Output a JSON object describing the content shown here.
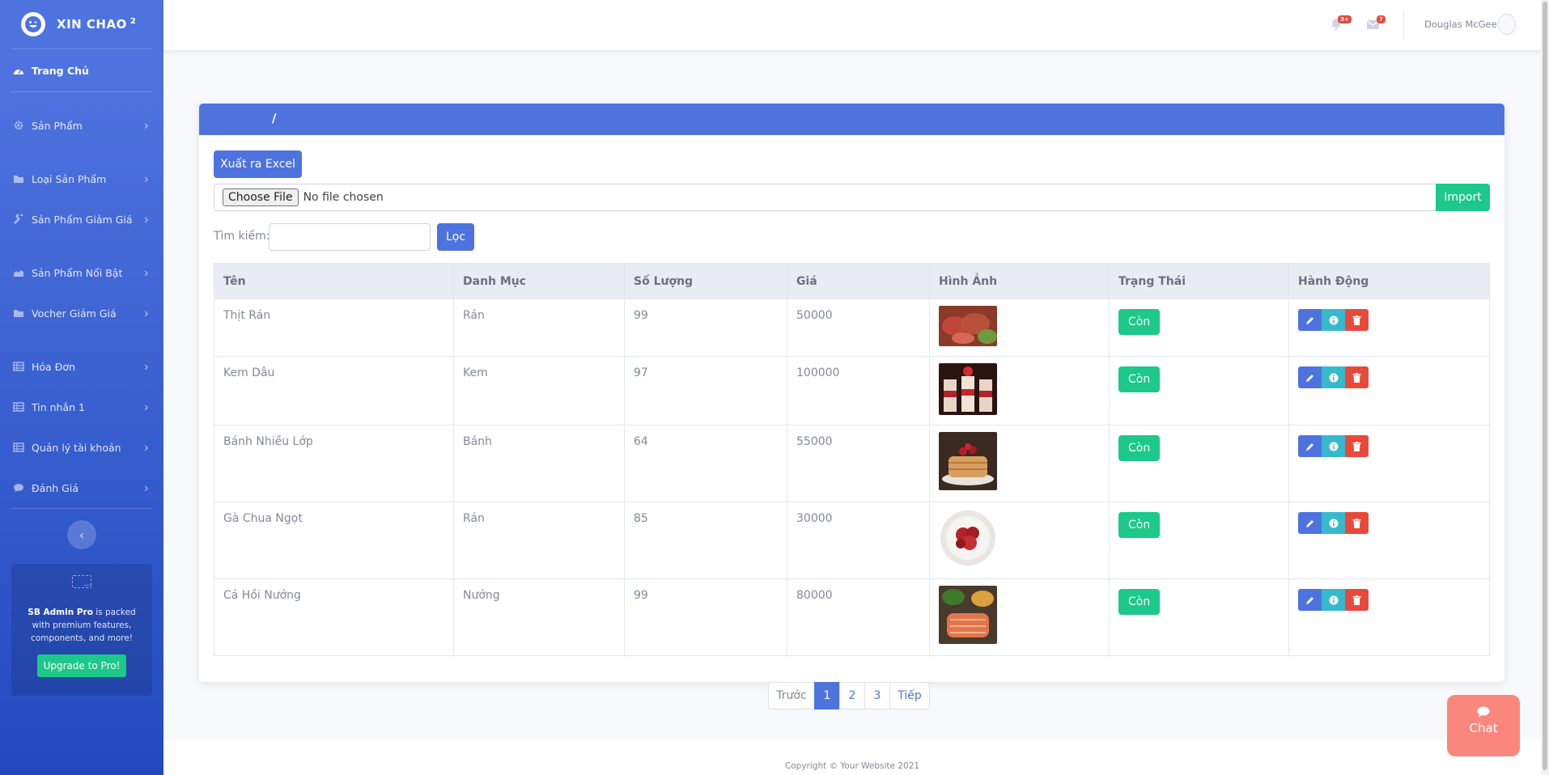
{
  "brand": {
    "title": "XIN CHAO",
    "sup": "2"
  },
  "sidebar": {
    "dashboard": "Trang Chủ",
    "items": [
      {
        "label": "Sản Phẩm"
      },
      {
        "label": "Loại Sản Phẩm"
      },
      {
        "label": "Sản Phẩm Giảm Giá"
      },
      {
        "label": "Sản Phẩm Nổi Bật"
      },
      {
        "label": "Vocher Giảm Giá"
      },
      {
        "label": "Hóa Đơn"
      },
      {
        "label": "Tin nhắn 1"
      },
      {
        "label": "Quản lý tài khoản"
      },
      {
        "label": "Đánh Giá"
      }
    ],
    "promo": {
      "brand": "SB Admin Pro",
      "text": "is packed with premium features, components, and more!",
      "button": "Upgrade to Pro!"
    }
  },
  "topbar": {
    "alerts_badge": "3+",
    "messages_badge": "7",
    "username": "Douglas McGee"
  },
  "card": {
    "header": "/",
    "export_button": "Xuất ra Excel",
    "file_button": "Choose File",
    "file_status": "No file chosen",
    "import_button": "Import",
    "search_label": "Tìm kiếm:",
    "filter_button": "Lọc"
  },
  "table": {
    "headers": [
      "Tên",
      "Danh Mục",
      "Số Lượng",
      "Giá",
      "Hình Ảnh",
      "Trạng Thái",
      "Hành Động"
    ],
    "rows": [
      {
        "name": "Thịt Rán",
        "category": "Rán",
        "qty": "99",
        "price": "50000",
        "status": "Còn"
      },
      {
        "name": "Kem Dâu",
        "category": "Kem",
        "qty": "97",
        "price": "100000",
        "status": "Còn"
      },
      {
        "name": "Bánh Nhiều Lớp",
        "category": "Bánh",
        "qty": "64",
        "price": "55000",
        "status": "Còn"
      },
      {
        "name": "Gà Chua Ngọt",
        "category": "Rán",
        "qty": "85",
        "price": "30000",
        "status": "Còn"
      },
      {
        "name": "Cá Hồi Nướng",
        "category": "Nướng",
        "qty": "99",
        "price": "80000",
        "status": "Còn"
      }
    ]
  },
  "pagination": {
    "prev": "Trước",
    "pages": [
      "1",
      "2",
      "3"
    ],
    "active": "1",
    "next": "Tiếp"
  },
  "footer": "Copyright © Your Website 2021",
  "chat": "Chat",
  "colors": {
    "primary": "#4e73df",
    "success": "#1cc88a",
    "info": "#36b9cc",
    "danger": "#e74a3b",
    "chat": "#f9877e"
  }
}
